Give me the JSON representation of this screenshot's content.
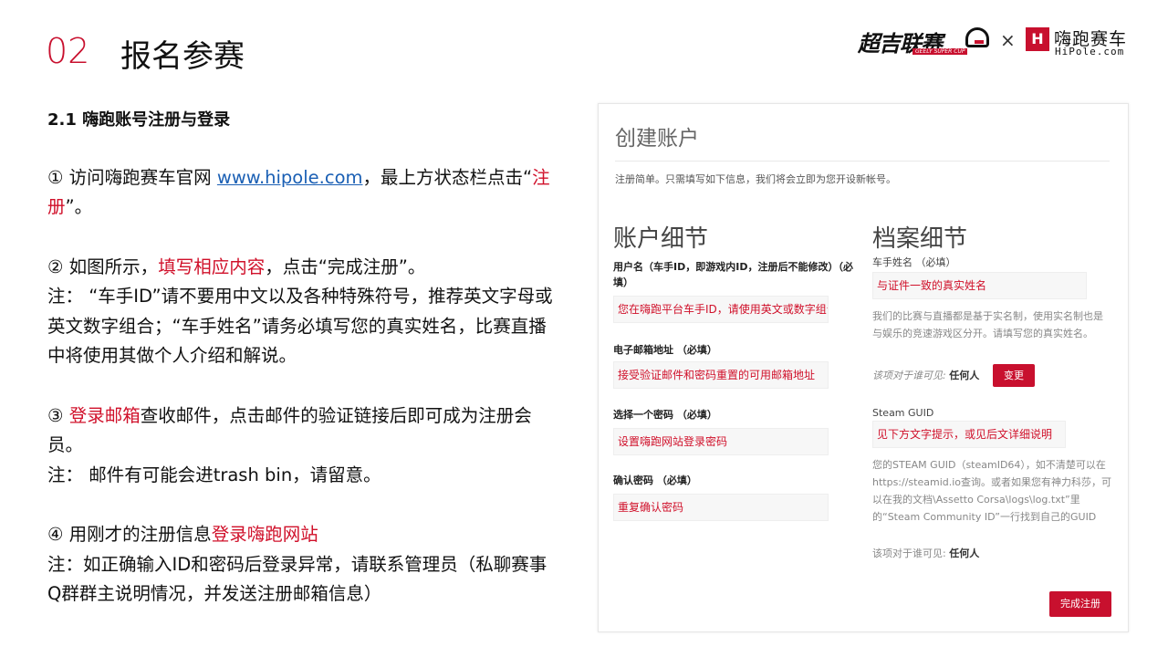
{
  "header": {
    "section_number": "02",
    "section_title": "报名参赛",
    "logo_geely": "超吉联赛",
    "logo_geely_sub": "GEELY SUPER CUP",
    "logo_times": "×",
    "logo_hipole_mark": "H",
    "logo_hipole_cn": "嗨跑赛车",
    "logo_hipole_en": "HiPole.com"
  },
  "left": {
    "subhead": "2.1 嗨跑账号注册与登录",
    "step1_a": "① 访问嗨跑赛车官网 ",
    "step1_link": "www.hipole.com",
    "step1_b": "，最上方状态栏点击“",
    "step1_red": "注册",
    "step1_c": "”。",
    "step2_a": "② 如图所示，",
    "step2_red": "填写相应内容",
    "step2_b": "，点击“完成注册”。",
    "note2": "注： “车手ID”请不要用中文以及各种特殊符号，推荐英文字母或英文数字组合；“车手姓名”请务必填写您的真实姓名，比赛直播中将使用其做个人介绍和解说。",
    "step3_a": "③ ",
    "step3_red": "登录邮箱",
    "step3_b": "查收邮件，点击邮件的验证链接后即可成为注册会员。",
    "note3": "注： 邮件有可能会进trash bin，请留意。",
    "step4_a": "④ 用刚才的注册信息",
    "step4_red": "登录嗨跑网站",
    "note4": "注：如正确输入ID和密码后登录异常，请联系管理员（私聊赛事Q群群主说明情况，并发送注册邮箱信息）"
  },
  "form": {
    "title": "创建账户",
    "intro": "注册简单。只需填写如下信息，我们将会立即为您开设新帐号。",
    "account_heading": "账户细节",
    "profile_heading": "档案细节",
    "username_label": "用户名（车手ID，即游戏内ID，注册后不能修改）（必填）",
    "username_hint": "您在嗨跑平台车手ID，请使用英文或数字组合",
    "email_label": "电子邮箱地址 （必填）",
    "email_hint": "接受验证邮件和密码重置的可用邮箱地址",
    "password_label": "选择一个密码 （必填）",
    "password_hint": "设置嗨跑网站登录密码",
    "confirm_label": "确认密码 （必填）",
    "confirm_hint": "重复确认密码",
    "realname_label": "车手姓名 （必填）",
    "realname_hint": "与证件一致的真实姓名",
    "realname_help": "我们的比赛与直播都是基于实名制，使用实名制也是与娱乐的竞速游戏区分开。请填写您的真实姓名。",
    "visibility_prefix": "该项对于谁可见:",
    "visibility_value": "任何人",
    "change_button": "变更",
    "steam_label": "Steam GUID",
    "steam_hint": "见下方文字提示，或见后文详细说明",
    "steam_help": "您的STEAM GUID（steamID64），如不清楚可以在https://steamid.io查询。或者如果您有神力科莎，可以在我的文档\\Assetto Corsa\\logs\\log.txt”里的“Steam Community ID”一行找到自己的GUID",
    "steam_visibility_prefix": "该项对于谁可见:",
    "steam_visibility_value": "任何人",
    "submit_button": "完成注册"
  }
}
